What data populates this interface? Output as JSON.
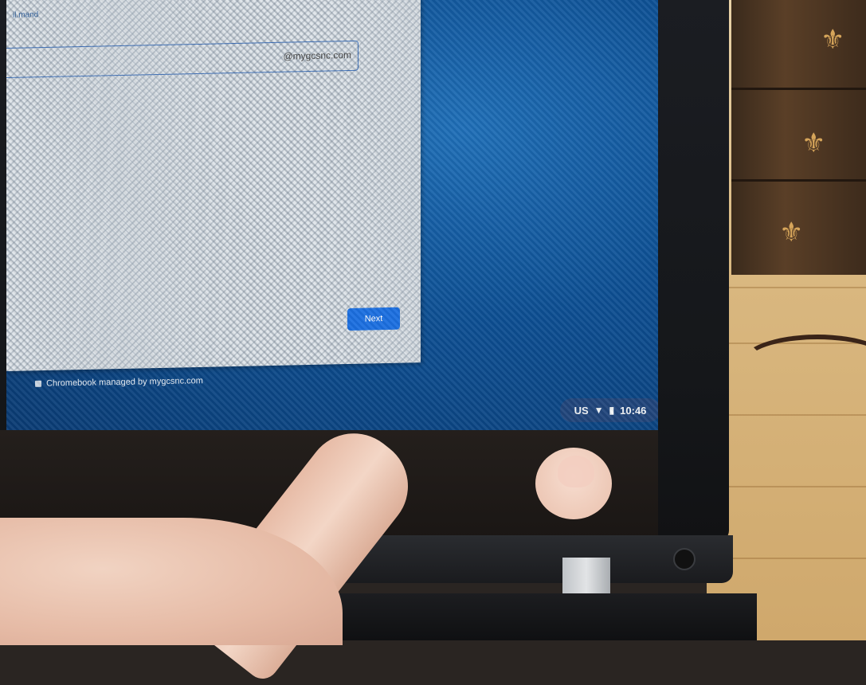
{
  "dialog": {
    "email_label": "il.mand",
    "email_domain_suffix": "@mygcsnc.com",
    "next_label": "Next"
  },
  "footer": {
    "managed_text": "Chromebook managed by mygcsnc.com"
  },
  "shelf": {
    "keyboard_layout": "US",
    "wifi_icon": "wifi-icon",
    "battery_icon": "battery-icon",
    "time": "10:46"
  },
  "colors": {
    "screen_blue": "#0d4f93",
    "button_blue": "#1b6fe0"
  }
}
